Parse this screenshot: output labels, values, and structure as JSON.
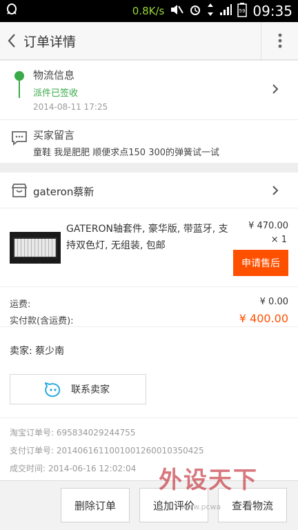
{
  "status_bar": {
    "speed": "0.8K/s",
    "time": "09:35",
    "battery": "59"
  },
  "header": {
    "title": "订单详情"
  },
  "logistics": {
    "title": "物流信息",
    "status": "派件已签收",
    "time": "2014-08-11 17:25"
  },
  "buyer_message": {
    "title": "买家留言",
    "text": "童鞋 我是肥肥 顺便求点150 300的弹簧试一试"
  },
  "shop": {
    "name": "gateron蔡新"
  },
  "item": {
    "title": "GATERON轴套件, 豪华版, 带蓝牙, 支持双色灯, 无组装, 包邮",
    "price": "¥ 470.00",
    "quantity": "× 1",
    "aftersale_label": "申请售后"
  },
  "fees": {
    "shipping_label": "运费:",
    "shipping_value": "¥ 0.00",
    "total_label": "实付款(含运费):",
    "total_value": "¥ 400.00"
  },
  "seller": {
    "label": "卖家: 蔡少南",
    "contact_label": "联系卖家"
  },
  "meta": {
    "taobao_order": "淘宝订单号: 695834029244755",
    "alipay_order": "支付订单号: 2014061611001001260010350425",
    "deal_time": "成交时间: 2014-06-16 12:02:04"
  },
  "bottom_bar": {
    "delete_label": "删除订单",
    "review_label": "追加评价",
    "logistics_label": "查看物流"
  },
  "watermark": {
    "text": "外设天下",
    "url": "www.pcwa"
  },
  "colors": {
    "accent": "#ff5000",
    "success": "#3aaa49",
    "contact": "#29a9e0"
  }
}
